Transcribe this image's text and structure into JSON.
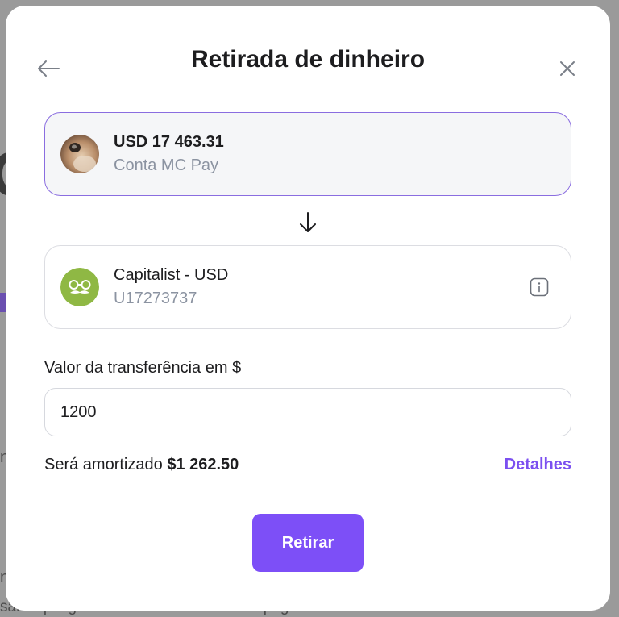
{
  "background": {
    "bottom_text": "sar o que ganhou antes de o YouTube pagar"
  },
  "modal": {
    "title": "Retirada de dinheiro",
    "back_icon": "arrow-left-icon",
    "close_icon": "close-icon"
  },
  "source": {
    "amount": "USD 17 463.31",
    "account": "Conta MC Pay",
    "avatar": "user-photo-avatar"
  },
  "destination": {
    "name": "Capitalist - USD",
    "account_id": "U17273737",
    "avatar": "capitalist-logo-icon",
    "avatar_color": "#8fb844",
    "info_icon": "info-icon"
  },
  "transfer": {
    "label": "Valor da transferência em $",
    "value": "1200"
  },
  "summary": {
    "prefix": "Será amortizado",
    "amount": "$1 262.50",
    "details_label": "Detalhes"
  },
  "submit_label": "Retirar",
  "colors": {
    "accent": "#7d4ff7",
    "link": "#7b4ff0",
    "source_border": "#8a6de0"
  }
}
